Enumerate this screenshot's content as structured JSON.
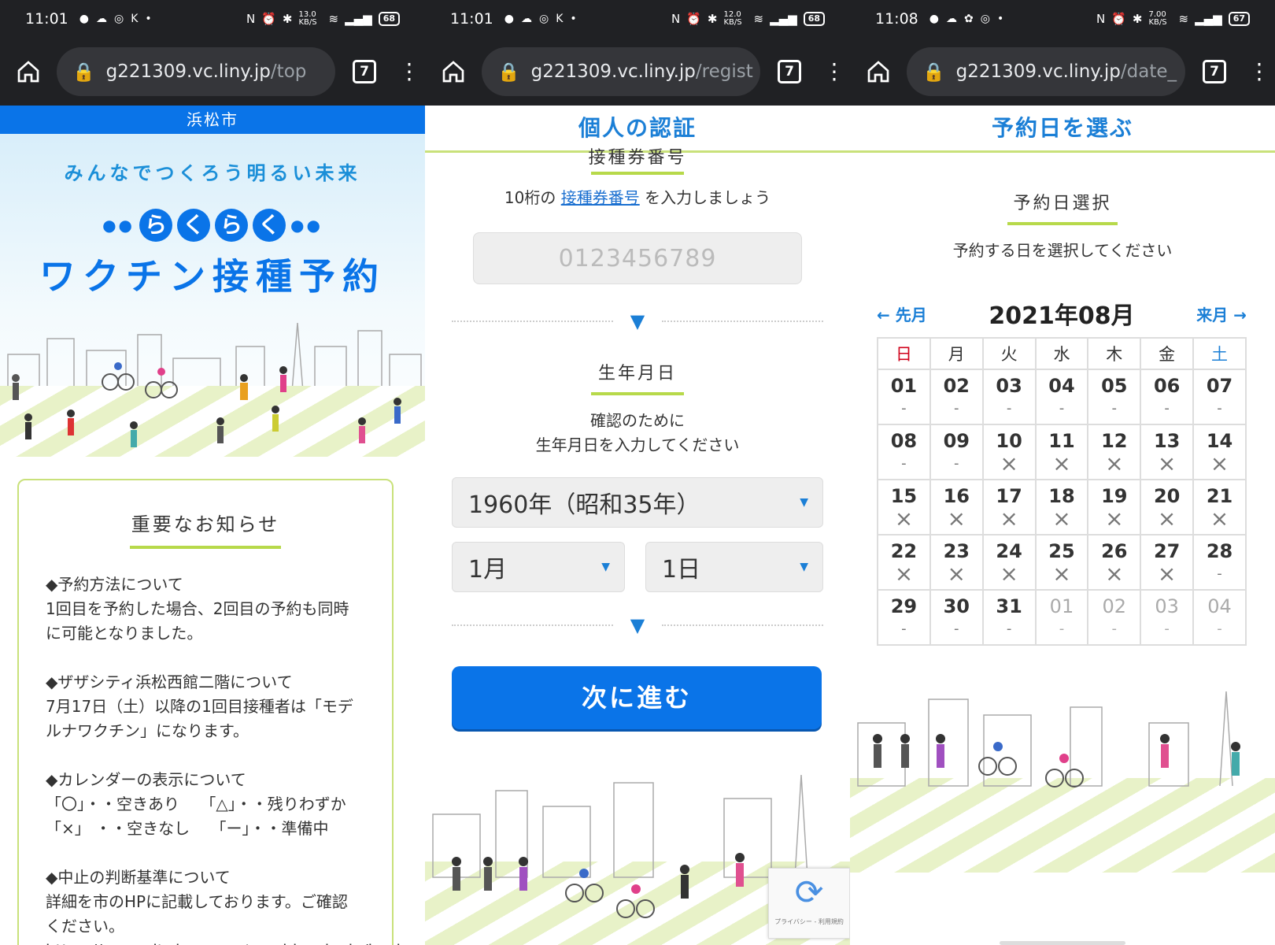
{
  "colors": {
    "brand_blue": "#0a74e8",
    "accent_green": "#b7d94a",
    "header_blue": "#1b7fd6",
    "sunday_red": "#d0021b"
  },
  "panels": [
    {
      "status": {
        "time": "11:01",
        "notif_icons": [
          "line-icon",
          "weather-icon",
          "instagram-icon",
          "ks-icon",
          "dot-icon"
        ],
        "speed": "13.0 KB/S",
        "battery": "68"
      },
      "browser": {
        "domain": "g221309.vc.liny.jp",
        "path": "/top",
        "tab_count": "7"
      }
    },
    {
      "status": {
        "time": "11:01",
        "notif_icons": [
          "line-icon",
          "weather-icon",
          "instagram-icon",
          "ks-icon",
          "dot-icon"
        ],
        "speed": "12.0 KB/S",
        "battery": "68"
      },
      "browser": {
        "domain": "g221309.vc.liny.jp",
        "path": "/regist",
        "tab_count": "7"
      }
    },
    {
      "status": {
        "time": "11:08",
        "notif_icons": [
          "line-icon",
          "weather-icon",
          "cat-icon",
          "instagram-icon",
          "dot-icon"
        ],
        "speed": "7.00 KB/S",
        "battery": "67"
      },
      "browser": {
        "domain": "g221309.vc.liny.jp",
        "path": "/date_",
        "tab_count": "7"
      }
    }
  ],
  "top": {
    "city": "浜松市",
    "tagline": "みんなでつくろう明るい未来",
    "raku": [
      "ら",
      "く",
      "ら",
      "く"
    ],
    "headline": "ワクチン接種予約",
    "notice_title": "重要なお知らせ",
    "notices": [
      "◆予約方法について\n1回目を予約した場合、2回目の予約も同時\nに可能となりました。",
      "◆ザザシティ浜松西館二階について\n7月17日（土）以降の1回目接種者は「モデ\nルナワクチン」になります。",
      "◆カレンダーの表示について\n「〇」・・空きあり　 「△」・・残りわずか\n「×」 ・・空きなし　 「ー」・・準備中",
      "◆中止の判断基準について\n詳細を市のHPに記載しております。ご確認\nください。"
    ],
    "notice_url": "https://www.city.hamamatsu.shizuoka.jp/kenkoz"
  },
  "regist": {
    "page_title": "個人の認証",
    "ticket_title": "接種券番号",
    "ticket_guide_pre": "10桁の ",
    "ticket_guide_link": "接種券番号",
    "ticket_guide_post": " を入力しましょう",
    "ticket_placeholder": "0123456789",
    "dob_title": "生年月日",
    "dob_guide_1": "確認のために",
    "dob_guide_2": "生年月日を入力してください",
    "year_value": "1960年（昭和35年）",
    "month_value": "1月",
    "day_value": "1日",
    "next_label": "次に進む",
    "recaptcha_text": "プライバシー - 利用規約"
  },
  "date": {
    "page_title": "予約日を選ぶ",
    "section_title": "予約日選択",
    "guide": "予約する日を選択してください",
    "prev": "先月",
    "next": "来月",
    "month": "2021年08月",
    "weekdays": [
      "日",
      "月",
      "火",
      "水",
      "木",
      "金",
      "土"
    ],
    "weeks": [
      [
        [
          "01",
          "-"
        ],
        [
          "02",
          "-"
        ],
        [
          "03",
          "-"
        ],
        [
          "04",
          "-"
        ],
        [
          "05",
          "-"
        ],
        [
          "06",
          "-"
        ],
        [
          "07",
          "-"
        ]
      ],
      [
        [
          "08",
          "-"
        ],
        [
          "09",
          "-"
        ],
        [
          "10",
          "×"
        ],
        [
          "11",
          "×"
        ],
        [
          "12",
          "×"
        ],
        [
          "13",
          "×"
        ],
        [
          "14",
          "×"
        ]
      ],
      [
        [
          "15",
          "×"
        ],
        [
          "16",
          "×"
        ],
        [
          "17",
          "×"
        ],
        [
          "18",
          "×"
        ],
        [
          "19",
          "×"
        ],
        [
          "20",
          "×"
        ],
        [
          "21",
          "×"
        ]
      ],
      [
        [
          "22",
          "×"
        ],
        [
          "23",
          "×"
        ],
        [
          "24",
          "×"
        ],
        [
          "25",
          "×"
        ],
        [
          "26",
          "×"
        ],
        [
          "27",
          "×"
        ],
        [
          "28",
          "-"
        ]
      ],
      [
        [
          "29",
          "-"
        ],
        [
          "30",
          "-"
        ],
        [
          "31",
          "-"
        ],
        [
          "01",
          "-"
        ],
        [
          "02",
          "-"
        ],
        [
          "03",
          "-"
        ],
        [
          "04",
          "-"
        ]
      ]
    ],
    "other_month_from_week": 4,
    "other_month_from_col": 3
  }
}
